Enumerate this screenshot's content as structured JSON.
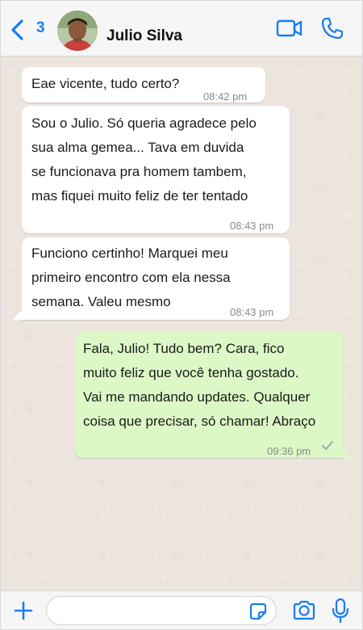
{
  "header": {
    "back_count": "3",
    "contact_name": "Julio Silva"
  },
  "messages": [
    {
      "direction": "incoming",
      "lines": [
        "Eae vicente, tudo certo?"
      ],
      "time": "08:42 pm"
    },
    {
      "direction": "incoming",
      "lines": [
        "Sou o Julio. Só queria agradece pelo",
        "sua alma gemea... Tava em duvida",
        "se funcionava pra homem tambem,",
        "mas fiquei muito feliz de ter tentado"
      ],
      "time": "08:43 pm"
    },
    {
      "direction": "incoming",
      "lines": [
        "Funciono certinho! Marquei meu",
        "primeiro encontro com ela nessa",
        "semana. Valeu mesmo"
      ],
      "time": "08:43 pm"
    },
    {
      "direction": "outgoing",
      "lines": [
        "Fala, Julio! Tudo bem? Cara, fico",
        "muito feliz que você tenha gostado.",
        "Vai me mandando updates. Qualquer",
        "coisa que precisar, só chamar! Abraço"
      ],
      "time": "09:36 pm",
      "status": "sent-check"
    }
  ],
  "icons": {
    "back": "chevron-left-icon",
    "video": "video-camera-icon",
    "phone": "phone-icon",
    "add": "plus-icon",
    "sticker": "sticker-icon",
    "camera": "camera-icon",
    "mic": "microphone-icon"
  },
  "colors": {
    "accent": "#1a7cf1",
    "chat_background": "#ece5dd",
    "incoming_bubble": "#ffffff",
    "outgoing_bubble": "#dcf8c6",
    "timestamp": "#8a8a8a"
  }
}
